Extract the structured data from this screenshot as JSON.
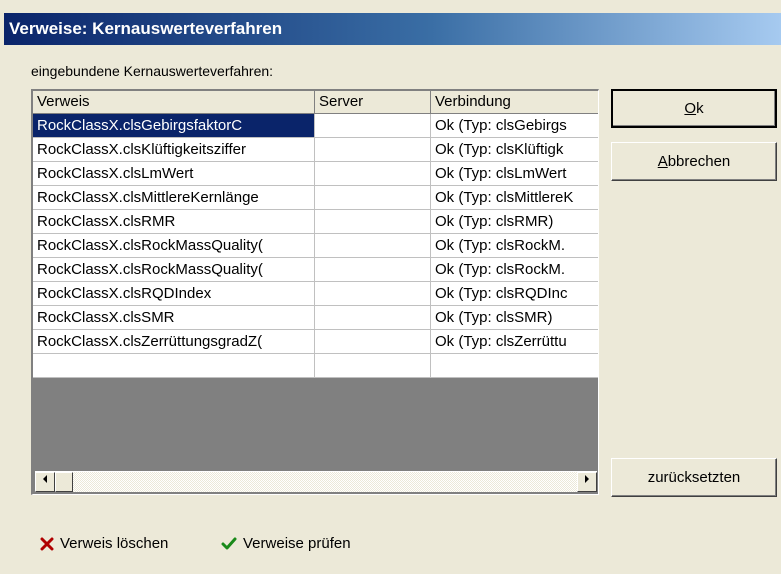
{
  "window": {
    "title": "Verweise: Kernauswerteverfahren"
  },
  "caption": "eingebundene Kernauswerteverfahren:",
  "grid": {
    "columns": [
      "Verweis",
      "Server",
      "Verbindung"
    ],
    "rows": [
      {
        "verweis": "RockClassX.clsGebirgsfaktorC",
        "server": "",
        "verbindung": "Ok (Typ: clsGebirgs",
        "selected": true
      },
      {
        "verweis": "RockClassX.clsKlüftigkeitsziffer",
        "server": "",
        "verbindung": "Ok (Typ: clsKlüftigk"
      },
      {
        "verweis": "RockClassX.clsLmWert",
        "server": "",
        "verbindung": "Ok (Typ: clsLmWert"
      },
      {
        "verweis": "RockClassX.clsMittlereKernlänge",
        "server": "",
        "verbindung": "Ok (Typ: clsMittlereK"
      },
      {
        "verweis": "RockClassX.clsRMR",
        "server": "",
        "verbindung": "Ok (Typ: clsRMR)"
      },
      {
        "verweis": "RockClassX.clsRockMassQuality(",
        "server": "",
        "verbindung": "Ok (Typ: clsRockM."
      },
      {
        "verweis": "RockClassX.clsRockMassQuality(",
        "server": "",
        "verbindung": "Ok (Typ: clsRockM."
      },
      {
        "verweis": "RockClassX.clsRQDIndex",
        "server": "",
        "verbindung": "Ok (Typ: clsRQDInc"
      },
      {
        "verweis": "RockClassX.clsSMR",
        "server": "",
        "verbindung": "Ok (Typ: clsSMR)"
      },
      {
        "verweis": "RockClassX.clsZerrüttungsgradZ(",
        "server": "",
        "verbindung": "Ok (Typ: clsZerrüttu"
      },
      {
        "verweis": "",
        "server": "",
        "verbindung": ""
      }
    ]
  },
  "buttons": {
    "ok": {
      "mnemonic": "O",
      "rest": "k"
    },
    "abbrechen": {
      "mnemonic": "A",
      "rest": "bbrechen"
    },
    "reset": "zurücksetzten"
  },
  "toolbar": {
    "delete_label": "Verweis löschen",
    "check_label": "Verweise prüfen"
  },
  "colors": {
    "delete_icon": "#b00000",
    "check_icon": "#1a8a1a",
    "selection": "#0a246a"
  }
}
